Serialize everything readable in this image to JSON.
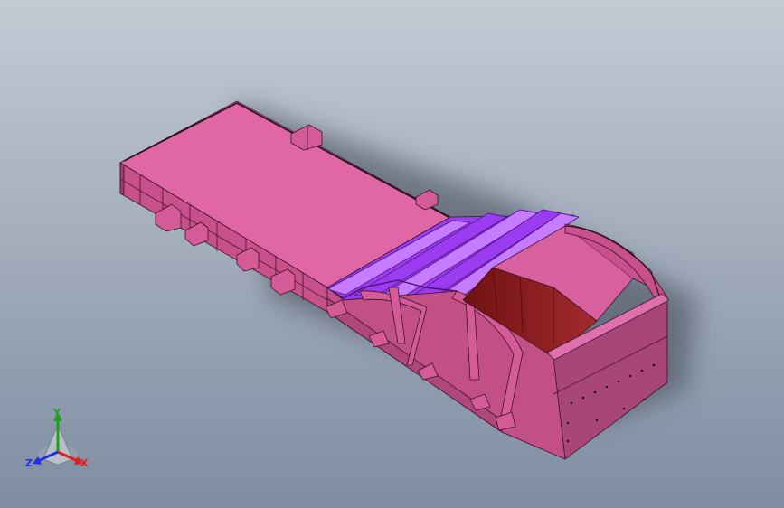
{
  "viewport": {
    "background_top": "#c4cad4",
    "background_bottom": "#7f8da2"
  },
  "model": {
    "cover_color": "#e066a6",
    "side_color": "#c8508c",
    "housing_color": "#c24f86",
    "gate_color": "#8d1d1f",
    "bar_color": "#9b3cf0",
    "bar_highlight": "#c77bff",
    "edge_color": "#3a1528"
  },
  "triad": {
    "icon": "view-orientation-triad-icon",
    "x_label": "X",
    "y_label": "Y",
    "z_label": "Z",
    "x_color": "#e21d1d",
    "y_color": "#20a020",
    "z_color": "#2030e0"
  }
}
